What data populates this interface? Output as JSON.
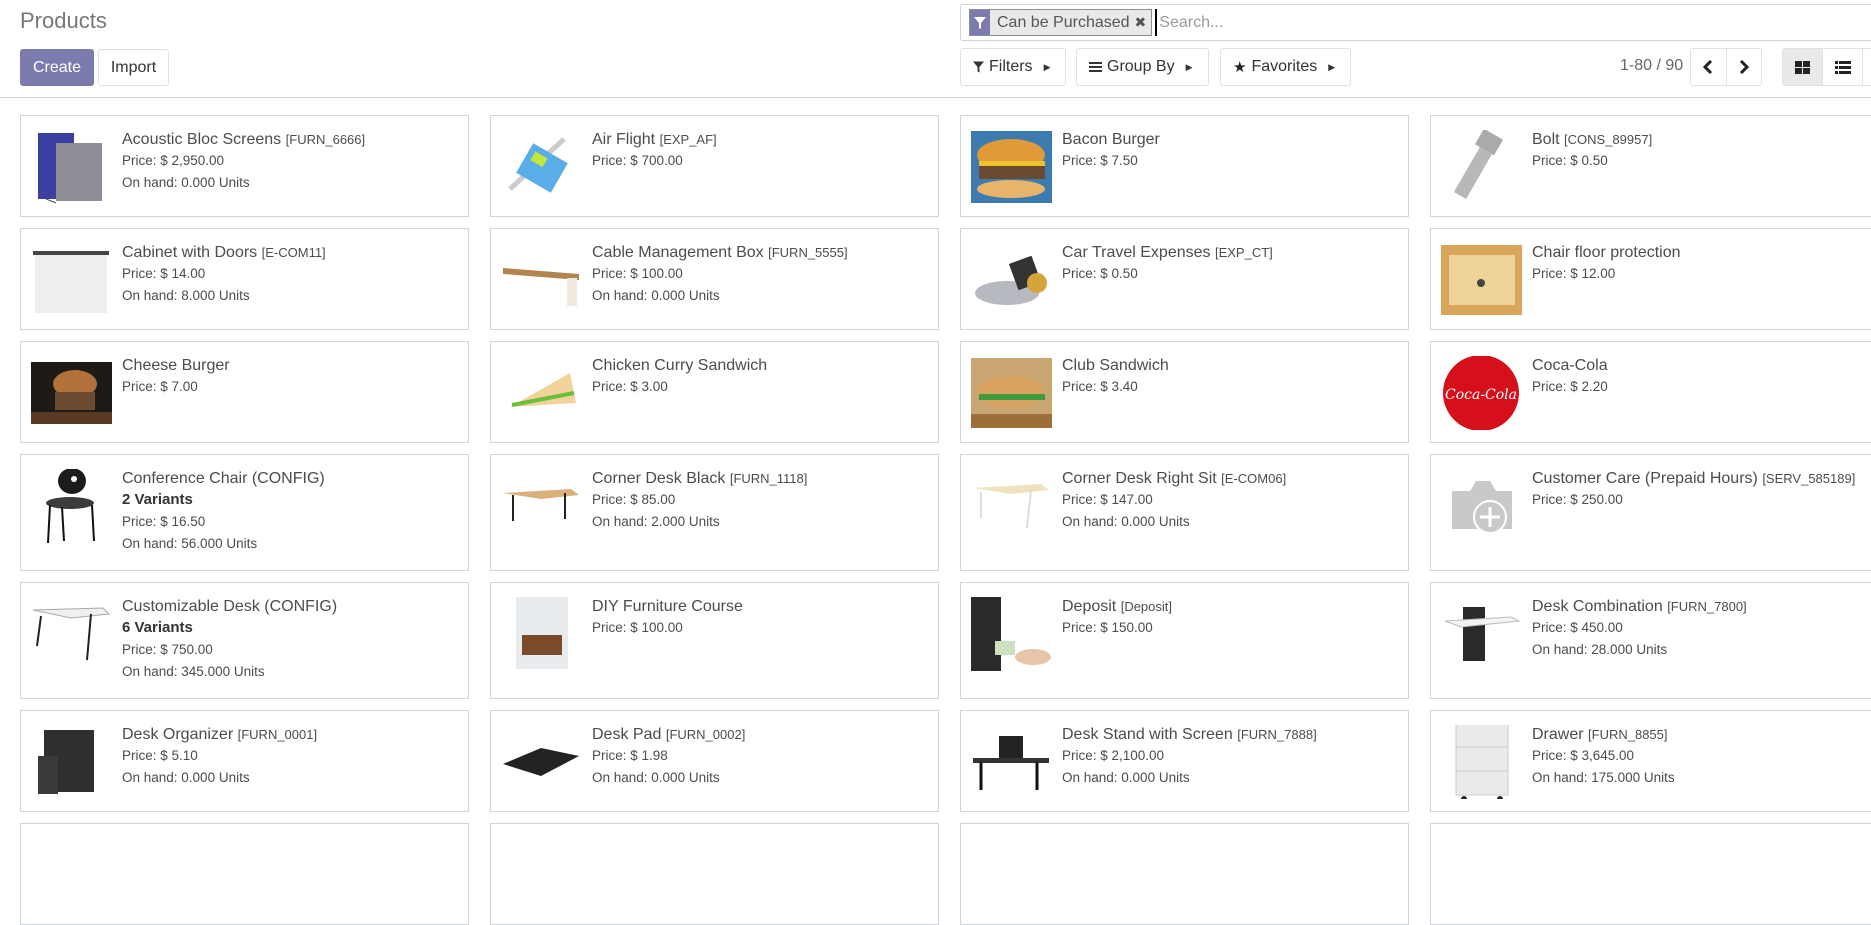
{
  "header": {
    "title": "Products",
    "create_label": "Create",
    "import_label": "Import"
  },
  "search": {
    "facet_icon": "filter-icon",
    "facet_label": "Can be Purchased",
    "facet_remove_icon": "close-icon",
    "placeholder": "Search...",
    "value": ""
  },
  "search_options": {
    "filters_label": "Filters",
    "groupby_label": "Group By",
    "favorites_label": "Favorites"
  },
  "pager": {
    "value": "1-80 / 90",
    "prev_icon": "chevron-left-icon",
    "next_icon": "chevron-right-icon"
  },
  "views": {
    "active": "kanban",
    "items": [
      "kanban",
      "list"
    ]
  },
  "colors": {
    "brand": "#7c7bad",
    "card_border": "#d0d4db"
  },
  "products": [
    {
      "name": "Acoustic Bloc Screens",
      "code": "[FURN_6666]",
      "price": "Price: $ 2,950.00",
      "onhand": "On hand: 0.000 Units",
      "variants": "",
      "image": "acoustic-screens"
    },
    {
      "name": "Air Flight",
      "code": "[EXP_AF]",
      "price": "Price: $ 700.00",
      "onhand": "",
      "variants": "",
      "image": "air-ticket"
    },
    {
      "name": "Bacon Burger",
      "code": "",
      "price": "Price: $ 7.50",
      "onhand": "",
      "variants": "",
      "image": "burger"
    },
    {
      "name": "Bolt",
      "code": "[CONS_89957]",
      "price": "Price: $ 0.50",
      "onhand": "",
      "variants": "",
      "image": "bolt"
    },
    {
      "name": "Cabinet with Doors",
      "code": "[E-COM11]",
      "price": "Price: $ 14.00",
      "onhand": "On hand: 8.000 Units",
      "variants": "",
      "image": "cabinet"
    },
    {
      "name": "Cable Management Box",
      "code": "[FURN_5555]",
      "price": "Price: $ 100.00",
      "onhand": "On hand: 0.000 Units",
      "variants": "",
      "image": "cable-box"
    },
    {
      "name": "Car Travel Expenses",
      "code": "[EXP_CT]",
      "price": "Price: $ 0.50",
      "onhand": "",
      "variants": "",
      "image": "car"
    },
    {
      "name": "Chair floor protection",
      "code": "",
      "price": "Price: $ 12.00",
      "onhand": "",
      "variants": "",
      "image": "floor-mat"
    },
    {
      "name": "Cheese Burger",
      "code": "",
      "price": "Price: $ 7.00",
      "onhand": "",
      "variants": "",
      "image": "cheese-burger"
    },
    {
      "name": "Chicken Curry Sandwich",
      "code": "",
      "price": "Price: $ 3.00",
      "onhand": "",
      "variants": "",
      "image": "sandwich"
    },
    {
      "name": "Club Sandwich",
      "code": "",
      "price": "Price: $ 3.40",
      "onhand": "",
      "variants": "",
      "image": "club-sandwich"
    },
    {
      "name": "Coca-Cola",
      "code": "",
      "price": "Price: $ 2.20",
      "onhand": "",
      "variants": "",
      "image": "coca-cola"
    },
    {
      "name": "Conference Chair (CONFIG)",
      "code": "",
      "price": "Price: $ 16.50",
      "onhand": "On hand: 56.000 Units",
      "variants": "2 Variants",
      "image": "chair"
    },
    {
      "name": "Corner Desk Black",
      "code": "[FURN_1118]",
      "price": "Price: $ 85.00",
      "onhand": "On hand: 2.000 Units",
      "variants": "",
      "image": "desk-black"
    },
    {
      "name": "Corner Desk Right Sit",
      "code": "[E-COM06]",
      "price": "Price: $ 147.00",
      "onhand": "On hand: 0.000 Units",
      "variants": "",
      "image": "desk-white"
    },
    {
      "name": "Customer Care (Prepaid Hours)",
      "code": "[SERV_585189]",
      "price": "Price: $ 250.00",
      "onhand": "",
      "variants": "",
      "image": "placeholder-camera"
    },
    {
      "name": "Customizable Desk (CONFIG)",
      "code": "",
      "price": "Price: $ 750.00",
      "onhand": "On hand: 345.000 Units",
      "variants": "6 Variants",
      "image": "desk-custom"
    },
    {
      "name": "DIY Furniture Course",
      "code": "",
      "price": "Price: $ 100.00",
      "onhand": "",
      "variants": "",
      "image": "book"
    },
    {
      "name": "Deposit",
      "code": "[Deposit]",
      "price": "Price: $ 150.00",
      "onhand": "",
      "variants": "",
      "image": "money"
    },
    {
      "name": "Desk Combination",
      "code": "[FURN_7800]",
      "price": "Price: $ 450.00",
      "onhand": "On hand: 28.000 Units",
      "variants": "",
      "image": "desk-combo"
    },
    {
      "name": "Desk Organizer",
      "code": "[FURN_0001]",
      "price": "Price: $ 5.10",
      "onhand": "On hand: 0.000 Units",
      "variants": "",
      "image": "organizer"
    },
    {
      "name": "Desk Pad",
      "code": "[FURN_0002]",
      "price": "Price: $ 1.98",
      "onhand": "On hand: 0.000 Units",
      "variants": "",
      "image": "desk-pad"
    },
    {
      "name": "Desk Stand with Screen",
      "code": "[FURN_7888]",
      "price": "Price: $ 2,100.00",
      "onhand": "On hand: 0.000 Units",
      "variants": "",
      "image": "desk-stand"
    },
    {
      "name": "Drawer",
      "code": "[FURN_8855]",
      "price": "Price: $ 3,645.00",
      "onhand": "On hand: 175.000 Units",
      "variants": "",
      "image": "drawer"
    },
    {
      "name": "",
      "code": "",
      "price": "",
      "onhand": "",
      "variants": "",
      "image": ""
    },
    {
      "name": "",
      "code": "",
      "price": "",
      "onhand": "",
      "variants": "",
      "image": ""
    },
    {
      "name": "",
      "code": "",
      "price": "",
      "onhand": "",
      "variants": "",
      "image": ""
    },
    {
      "name": "",
      "code": "",
      "price": "",
      "onhand": "",
      "variants": "",
      "image": ""
    }
  ]
}
